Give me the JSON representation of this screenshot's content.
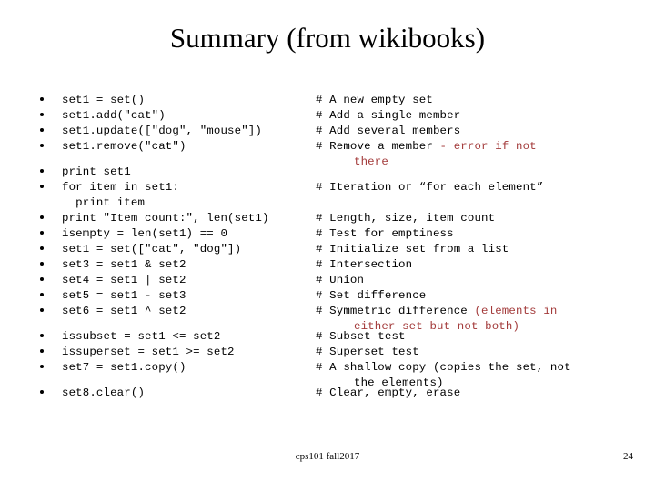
{
  "slide": {
    "title": "Summary (from wikibooks)",
    "footer_text": "cps101 fall2017",
    "page_number": "24",
    "accent_red": "#a33a3a",
    "text_color": "#000000",
    "background": "#ffffff"
  },
  "lines": [
    {
      "code": "set1 = set()",
      "comment": "# A new empty set",
      "comment_red": "",
      "comment_red_cont": "",
      "gap_before": false
    },
    {
      "code": "set1.add(\"cat\")",
      "comment": "# Add a single member",
      "comment_red": "",
      "comment_red_cont": "",
      "gap_before": false
    },
    {
      "code": "set1.update([\"dog\", \"mouse\"])",
      "comment": "# Add several members",
      "comment_red": "",
      "comment_red_cont": "",
      "gap_before": false
    },
    {
      "code": "set1.remove(\"cat\")",
      "comment": "# Remove a member ",
      "comment_red": "- error if not",
      "comment_red_cont": "there",
      "gap_before": false
    },
    {
      "code": "print set1",
      "comment": "",
      "comment_red": "",
      "comment_red_cont": "",
      "gap_before": true
    },
    {
      "code": "for item in set1:\n  print item",
      "comment": "# Iteration or “for each element”",
      "comment_red": "",
      "comment_red_cont": "",
      "gap_before": false
    },
    {
      "code": "print \"Item count:\", len(set1)",
      "comment": "# Length, size, item count",
      "comment_red": "",
      "comment_red_cont": "",
      "gap_before": false
    },
    {
      "code": "isempty = len(set1) == 0",
      "comment": "# Test for emptiness",
      "comment_red": "",
      "comment_red_cont": "",
      "gap_before": false
    },
    {
      "code": "set1 = set([\"cat\", \"dog\"])",
      "comment": "# Initialize set from a list",
      "comment_red": "",
      "comment_red_cont": "",
      "gap_before": false
    },
    {
      "code": "set3 = set1 & set2",
      "comment": "# Intersection",
      "comment_red": "",
      "comment_red_cont": "",
      "gap_before": false
    },
    {
      "code": "set4 = set1 | set2",
      "comment": "# Union",
      "comment_red": "",
      "comment_red_cont": "",
      "gap_before": false
    },
    {
      "code": "set5 = set1 - set3",
      "comment": "# Set difference",
      "comment_red": "",
      "comment_red_cont": "",
      "gap_before": false
    },
    {
      "code": "set6 = set1 ^ set2",
      "comment": "# Symmetric difference ",
      "comment_red": "(elements in",
      "comment_red_cont": "either set but not both)",
      "gap_before": false
    },
    {
      "code": "issubset = set1 <= set2",
      "comment": "# Subset test",
      "comment_red": "",
      "comment_red_cont": "",
      "gap_before": true
    },
    {
      "code": "issuperset = set1 >= set2",
      "comment": "# Superset test",
      "comment_red": "",
      "comment_red_cont": "",
      "gap_before": false
    },
    {
      "code": "set7 = set1.copy()",
      "comment": "# A shallow copy (copies the set, not",
      "comment_red": "",
      "comment_red_cont": "the elements)",
      "gap_before": false
    },
    {
      "code": "set8.clear()",
      "comment": "# Clear, empty, erase",
      "comment_red": "",
      "comment_red_cont": "",
      "gap_before": true
    }
  ]
}
